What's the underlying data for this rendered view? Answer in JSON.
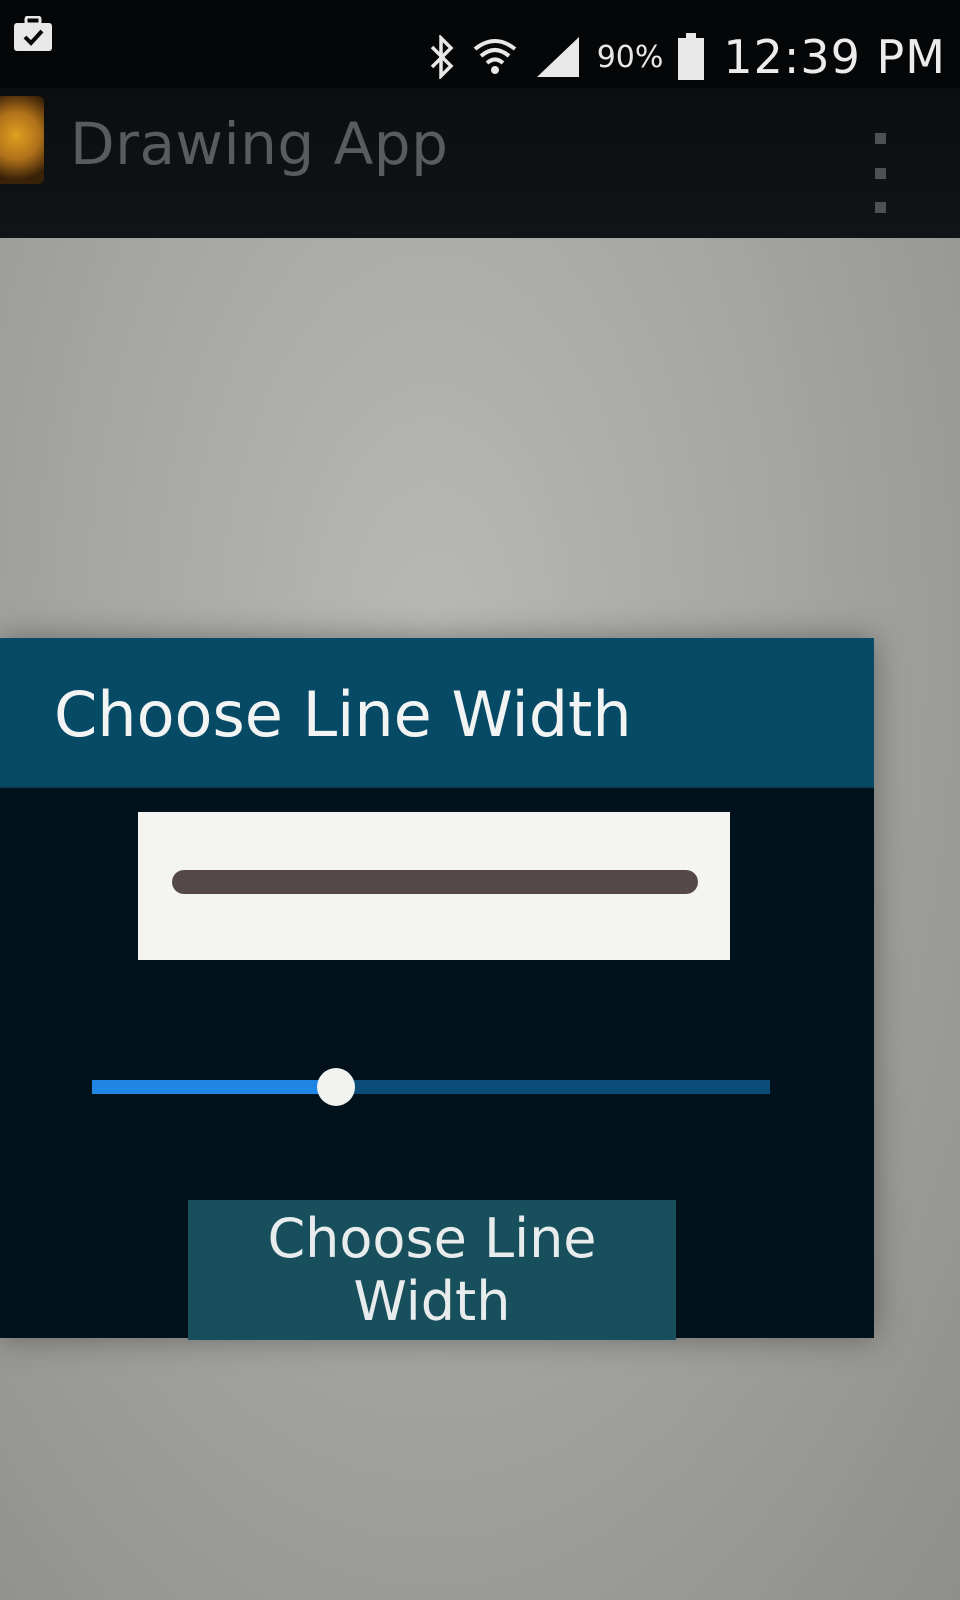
{
  "status_bar": {
    "notification_icon": "briefcase-check-icon",
    "icons": [
      "bluetooth-icon",
      "wifi-icon",
      "signal-icon",
      "battery-icon"
    ],
    "battery_percent": "90%",
    "time": "12:39 PM"
  },
  "action_bar": {
    "app_icon": "app-logo-icon",
    "title": "Drawing App",
    "overflow_icon": "overflow-menu-icon"
  },
  "dialog": {
    "title": "Choose Line Width",
    "preview_line_color": "#55484a",
    "slider": {
      "value_fraction": 0.36
    },
    "button_label": "Choose Line Width"
  },
  "colors": {
    "dialog_header": "#074a66",
    "dialog_body": "#02121c",
    "slider_fill": "#1f86e4",
    "slider_track": "#0b4d78",
    "button_bg": "#184f5c"
  }
}
